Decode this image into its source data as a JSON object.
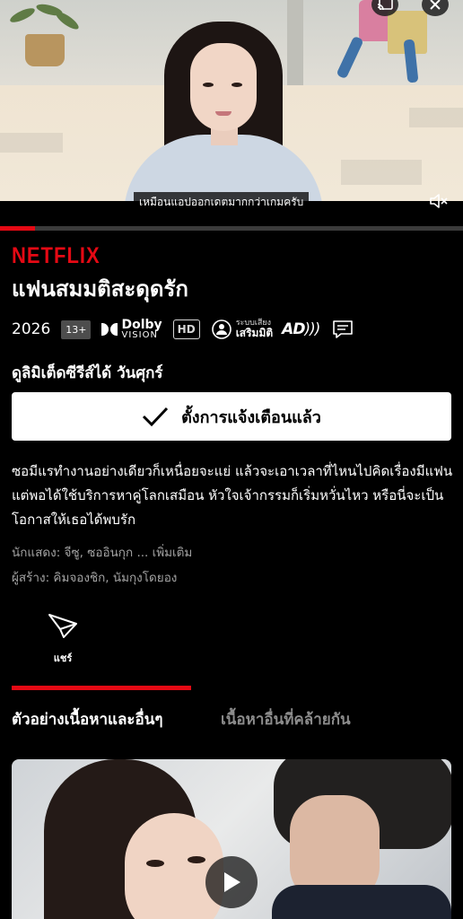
{
  "player": {
    "subtitle": "เหมือนแอปออกเดตมากกว่าเกมครับ",
    "progress_fraction": 0.075,
    "icons": [
      "cast-icon",
      "close-icon",
      "mute-icon",
      "play-icon"
    ]
  },
  "details": {
    "brand": "NETFLIX",
    "title": "แฟนสมมติสะดุดรัก",
    "year": "2026",
    "maturity_rating": "13+",
    "dolby_line1": "Dolby",
    "dolby_line2": "VISION",
    "hd": "HD",
    "spatial_line1": "ระบบเสียง",
    "spatial_line2": "เสริมมิติ",
    "ad": "AD",
    "release_note": "ดูลิมิเต็ดซีรีส์ได้ วันศุกร์",
    "remind_button": "ตั้งการแจ้งเตือนแล้ว",
    "synopsis": "ซอมีแรทำงานอย่างเดียวก็เหนื่อยจะแย่ แล้วจะเอาเวลาที่ไหนไปคิดเรื่องมีแฟน แต่พอได้ใช้บริการหาคู่โลกเสมือน หัวใจเจ้ากรรมก็เริ่มหวั่นไหว หรือนี่จะเป็นโอกาสให้เธอได้พบรัก",
    "cast_label": "นักแสดง: จีซู, ซออินกุก",
    "cast_more": "... เพิ่มเติม",
    "creator_label": "ผู้สร้าง: คิมจองชิก, นัมกุงโดยอง",
    "share_label": "แชร์"
  },
  "tabs": [
    {
      "label": "ตัวอย่างเนื้อหาและอื่นๆ",
      "active": true
    },
    {
      "label": "เนื้อหาอื่นที่คล้ายกัน",
      "active": false
    }
  ],
  "colors": {
    "brand_red": "#e50914",
    "background": "#000000",
    "muted_text": "#a3a3a3"
  }
}
